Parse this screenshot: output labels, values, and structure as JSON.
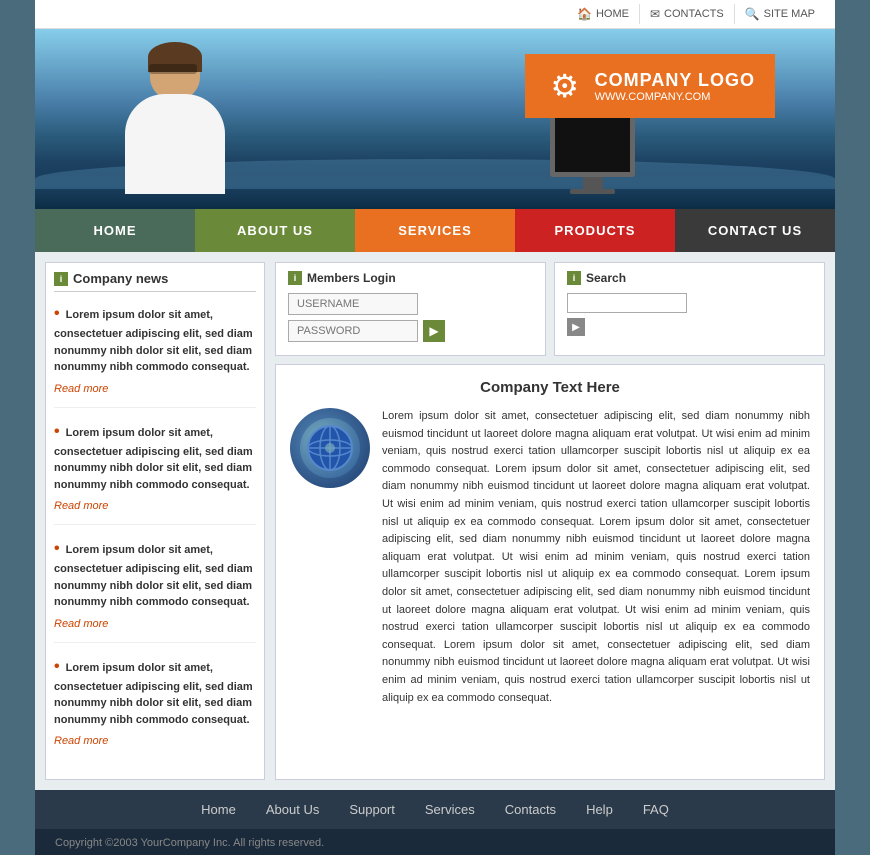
{
  "topbar": {
    "home_label": "HOME",
    "contacts_label": "CONTACTS",
    "sitemap_label": "SITE MAP"
  },
  "logo": {
    "title": "COMPANY LOGO",
    "url": "WWW.COMPANY.COM"
  },
  "nav": {
    "items": [
      {
        "label": "HOME",
        "class": "nav-home"
      },
      {
        "label": "ABOUT US",
        "class": "nav-about"
      },
      {
        "label": "SERVICES",
        "class": "nav-services"
      },
      {
        "label": "PRODUCTS",
        "class": "nav-products"
      },
      {
        "label": "CONTACT US",
        "class": "nav-contact"
      }
    ]
  },
  "sidebar": {
    "title": "Company news",
    "news": [
      {
        "text": "Lorem ipsum dolor sit amet, consectetuer adipiscing elit, sed diam nonummy nibh dolor sit elit, sed diam nonummy nibh commodo consequat.",
        "read_more": "Read more"
      },
      {
        "text": "Lorem ipsum dolor sit amet, consectetuer adipiscing elit, sed diam nonummy nibh dolor sit elit, sed diam nonummy nibh commodo consequat.",
        "read_more": "Read more"
      },
      {
        "text": "Lorem ipsum dolor sit amet, consectetuer adipiscing elit, sed diam nonummy nibh dolor sit elit, sed diam nonummy nibh commodo consequat.",
        "read_more": "Read more"
      },
      {
        "text": "Lorem ipsum dolor sit amet, consectetuer adipiscing elit, sed diam nonummy nibh dolor sit elit, sed diam nonummy nibh commodo consequat.",
        "read_more": "Read more"
      }
    ]
  },
  "login": {
    "title": "Members Login",
    "username_placeholder": "USERNAME",
    "password_placeholder": "PASSWORD"
  },
  "search": {
    "title": "Search",
    "placeholder": ""
  },
  "article": {
    "title": "Company Text Here",
    "body": "Lorem ipsum dolor sit amet, consectetuer adipiscing elit, sed diam nonummy nibh euismod tincidunt ut laoreet dolore magna aliquam erat volutpat. Ut wisi enim ad minim veniam, quis nostrud exerci tation ullamcorper suscipit lobortis nisl ut aliquip ex ea commodo consequat. Lorem ipsum dolor sit amet, consectetuer adipiscing elit, sed diam nonummy nibh euismod tincidunt ut laoreet dolore magna aliquam erat volutpat. Ut wisi enim ad minim veniam, quis nostrud exerci tation ullamcorper suscipit lobortis nisl ut aliquip ex ea commodo consequat. Lorem ipsum dolor sit amet, consectetuer adipiscing elit, sed diam nonummy nibh euismod tincidunt ut laoreet dolore magna aliquam erat volutpat. Ut wisi enim ad minim veniam, quis nostrud exerci tation ullamcorper suscipit lobortis nisl ut aliquip ex ea commodo consequat. Lorem ipsum dolor sit amet, consectetuer adipiscing elit, sed diam nonummy nibh euismod tincidunt ut laoreet dolore magna aliquam erat volutpat. Ut wisi enim ad minim veniam, quis nostrud exerci tation ullamcorper suscipit lobortis nisl ut aliquip ex ea commodo consequat. Lorem ipsum dolor sit amet, consectetuer adipiscing elit, sed diam nonummy nibh euismod tincidunt ut laoreet dolore magna aliquam erat volutpat. Ut wisi enim ad minim veniam, quis nostrud exerci tation ullamcorper suscipit lobortis nisl ut aliquip ex ea commodo consequat."
  },
  "footer": {
    "links": [
      {
        "label": "Home"
      },
      {
        "label": "About Us"
      },
      {
        "label": "Support"
      },
      {
        "label": "Services"
      },
      {
        "label": "Contacts"
      },
      {
        "label": "Help"
      },
      {
        "label": "FAQ"
      }
    ],
    "copyright": "Copyright ©2003 YourCompany Inc. All rights reserved."
  }
}
